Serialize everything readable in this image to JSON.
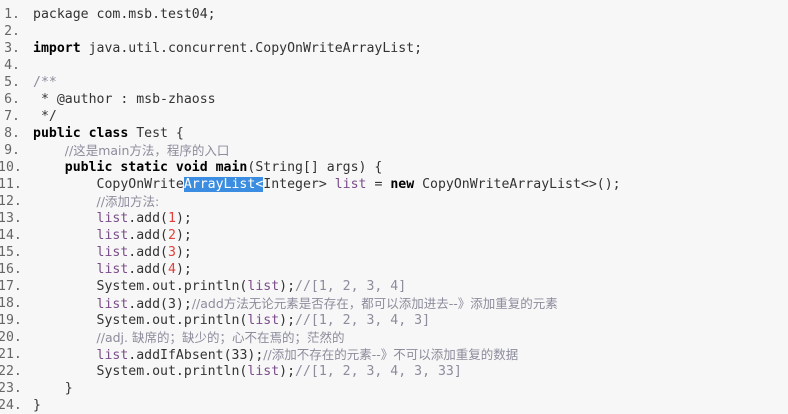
{
  "editor": {
    "lines": [
      {
        "n": "1.",
        "t": [
          {
            "c": "pln",
            "s": "package com.msb.test04;"
          }
        ]
      },
      {
        "n": "2.",
        "t": []
      },
      {
        "n": "3.",
        "t": [
          {
            "c": "kw",
            "s": "import"
          },
          {
            "c": "pln",
            "s": " java.util.concurrent.CopyOnWriteArrayList;"
          }
        ]
      },
      {
        "n": "4.",
        "t": []
      },
      {
        "n": "5.",
        "t": [
          {
            "c": "cm",
            "s": "/**"
          }
        ]
      },
      {
        "n": "6.",
        "t": [
          {
            "c": "pln",
            "s": " * @author : msb-zhaoss"
          }
        ]
      },
      {
        "n": "7.",
        "t": [
          {
            "c": "pln",
            "s": " */"
          }
        ]
      },
      {
        "n": "8.",
        "t": [
          {
            "c": "kw",
            "s": "public class"
          },
          {
            "c": "pln",
            "s": " Test {"
          }
        ]
      },
      {
        "n": "9.",
        "t": [
          {
            "c": "pln",
            "s": "    "
          },
          {
            "c": "cm",
            "s": "//这是main方法，程序的入口"
          }
        ]
      },
      {
        "n": "10.",
        "t": [
          {
            "c": "pln",
            "s": "    "
          },
          {
            "c": "kw",
            "s": "public static void main"
          },
          {
            "c": "pln",
            "s": "(String[] args) {"
          }
        ]
      },
      {
        "n": "11.",
        "t": [
          {
            "c": "pln",
            "s": "        CopyOnWrite"
          },
          {
            "c": "sel",
            "s": "ArrayList<"
          },
          {
            "c": "pln",
            "s": "Integer> "
          },
          {
            "c": "fld",
            "s": "list"
          },
          {
            "c": "pln",
            "s": " = "
          },
          {
            "c": "kw",
            "s": "new"
          },
          {
            "c": "pln",
            "s": " CopyOnWriteArrayList<>();"
          }
        ]
      },
      {
        "n": "12.",
        "t": [
          {
            "c": "pln",
            "s": "        "
          },
          {
            "c": "cm",
            "s": "//添加方法:"
          }
        ]
      },
      {
        "n": "13.",
        "t": [
          {
            "c": "pln",
            "s": "        "
          },
          {
            "c": "fld",
            "s": "list"
          },
          {
            "c": "pln",
            "s": ".add("
          },
          {
            "c": "num",
            "s": "1"
          },
          {
            "c": "pln",
            "s": ");"
          }
        ]
      },
      {
        "n": "14.",
        "t": [
          {
            "c": "pln",
            "s": "        "
          },
          {
            "c": "fld",
            "s": "list"
          },
          {
            "c": "pln",
            "s": ".add("
          },
          {
            "c": "num",
            "s": "2"
          },
          {
            "c": "pln",
            "s": ");"
          }
        ]
      },
      {
        "n": "15.",
        "t": [
          {
            "c": "pln",
            "s": "        "
          },
          {
            "c": "fld",
            "s": "list"
          },
          {
            "c": "pln",
            "s": ".add("
          },
          {
            "c": "num",
            "s": "3"
          },
          {
            "c": "pln",
            "s": ");"
          }
        ]
      },
      {
        "n": "16.",
        "t": [
          {
            "c": "pln",
            "s": "        "
          },
          {
            "c": "fld",
            "s": "list"
          },
          {
            "c": "pln",
            "s": ".add("
          },
          {
            "c": "num",
            "s": "4"
          },
          {
            "c": "pln",
            "s": ");"
          }
        ]
      },
      {
        "n": "17.",
        "t": [
          {
            "c": "pln",
            "s": "        System.out.println("
          },
          {
            "c": "fld",
            "s": "list"
          },
          {
            "c": "pln",
            "s": ");"
          },
          {
            "c": "cm",
            "s": "//[1, 2, 3, 4]"
          }
        ]
      },
      {
        "n": "18.",
        "t": [
          {
            "c": "pln",
            "s": "        "
          },
          {
            "c": "fld",
            "s": "list"
          },
          {
            "c": "pln",
            "s": ".add(3);"
          },
          {
            "c": "cm",
            "s": "//add方法无论元素是否存在，都可以添加进去--》添加重复的元素"
          }
        ]
      },
      {
        "n": "19.",
        "t": [
          {
            "c": "pln",
            "s": "        System.out.println("
          },
          {
            "c": "fld",
            "s": "list"
          },
          {
            "c": "pln",
            "s": ");"
          },
          {
            "c": "cm",
            "s": "//[1, 2, 3, 4, 3]"
          }
        ]
      },
      {
        "n": "20.",
        "t": [
          {
            "c": "pln",
            "s": "        "
          },
          {
            "c": "cm",
            "s": "//adj. 缺席的；缺少的；心不在焉的；茫然的"
          }
        ]
      },
      {
        "n": "21.",
        "t": [
          {
            "c": "pln",
            "s": "        "
          },
          {
            "c": "fld",
            "s": "list"
          },
          {
            "c": "pln",
            "s": ".addIfAbsent(33);"
          },
          {
            "c": "cm",
            "s": "//添加不存在的元素--》不可以添加重复的数据"
          }
        ]
      },
      {
        "n": "22.",
        "t": [
          {
            "c": "pln",
            "s": "        System.out.println("
          },
          {
            "c": "fld",
            "s": "list"
          },
          {
            "c": "pln",
            "s": ");"
          },
          {
            "c": "cm",
            "s": "//[1, 2, 3, 4, 3, 33]"
          }
        ]
      },
      {
        "n": "23.",
        "t": [
          {
            "c": "pln",
            "s": "    }"
          }
        ]
      },
      {
        "n": "24.",
        "t": [
          {
            "c": "pln",
            "s": "}"
          }
        ]
      }
    ]
  },
  "colors": {
    "background": "#f7f7f7",
    "keyword": "#000000",
    "comment": "#8c8c9c",
    "field": "#7a4c8a",
    "number": "#e0403a",
    "selection": "#3a8de0"
  }
}
